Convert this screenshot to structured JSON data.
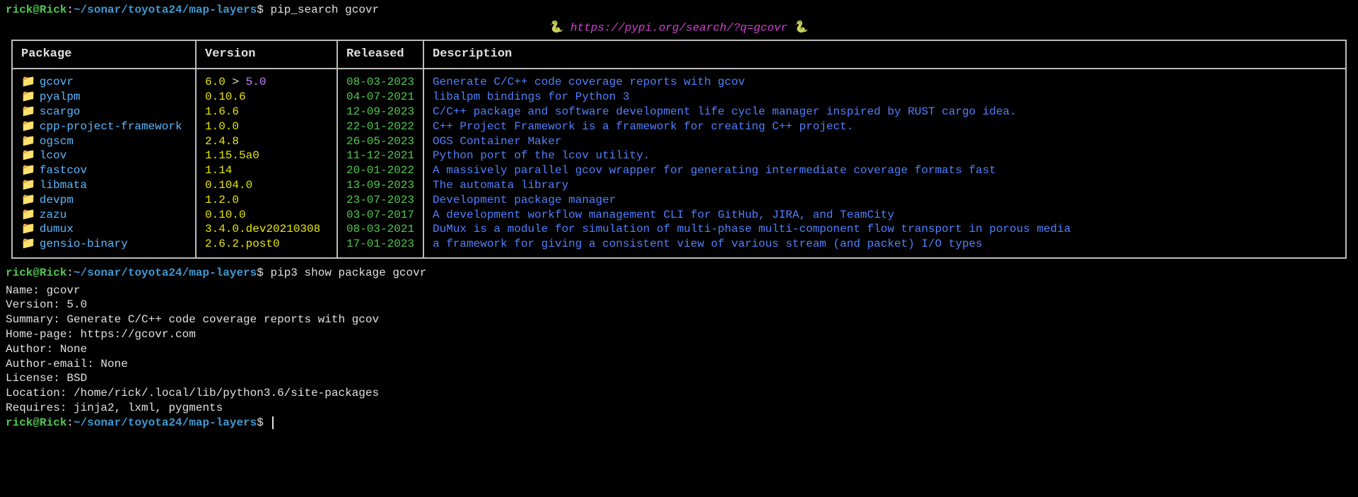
{
  "prompt1": {
    "userhost": "rick@Rick",
    "sep": ":",
    "path": "~/sonar/toyota24/map-layers",
    "dollar": "$",
    "cmd": "pip_search gcovr"
  },
  "search_url": "https://pypi.org/search/?q=gcovr",
  "table": {
    "headers": {
      "pkg": "Package",
      "ver": "Version",
      "rel": "Released",
      "desc": "Description"
    },
    "rows": [
      {
        "name": "gcovr",
        "ver_a": "6.0",
        "ver_op": " > ",
        "ver_b": "5.0",
        "released": "08-03-2023",
        "desc": "Generate C/C++ code coverage reports with gcov"
      },
      {
        "name": "pyalpm",
        "ver_a": "0.10.6",
        "released": "04-07-2021",
        "desc": "libalpm bindings for Python 3"
      },
      {
        "name": "scargo",
        "ver_a": "1.6.6",
        "released": "12-09-2023",
        "desc": "C/C++ package and software development life cycle manager inspired by RUST cargo idea."
      },
      {
        "name": "cpp-project-framework",
        "ver_a": "1.0.0",
        "released": "22-01-2022",
        "desc": "C++ Project Framework is a framework for creating C++ project."
      },
      {
        "name": "ogscm",
        "ver_a": "2.4.8",
        "released": "26-05-2023",
        "desc": "OGS Container Maker"
      },
      {
        "name": "lcov",
        "ver_a": "1.15.5a0",
        "released": "11-12-2021",
        "desc": "Python port of the lcov utility."
      },
      {
        "name": "fastcov",
        "ver_a": "1.14",
        "released": "20-01-2022",
        "desc": "A massively parallel gcov wrapper for generating intermediate coverage formats fast"
      },
      {
        "name": "libmata",
        "ver_a": "0.104.0",
        "released": "13-09-2023",
        "desc": "The automata library"
      },
      {
        "name": "devpm",
        "ver_a": "1.2.0",
        "released": "23-07-2023",
        "desc": "Development package manager"
      },
      {
        "name": "zazu",
        "ver_a": "0.10.0",
        "released": "03-07-2017",
        "desc": "A development workflow management CLI for GitHub, JIRA, and TeamCity"
      },
      {
        "name": "dumux",
        "ver_a": "3.4.0.dev20210308",
        "released": "08-03-2021",
        "desc": "DuMux is a module for simulation of multi-phase multi-component flow transport in porous media"
      },
      {
        "name": "gensio-binary",
        "ver_a": "2.6.2.post0",
        "released": "17-01-2023",
        "desc": "a framework for giving a consistent view of various stream (and packet) I/O types"
      }
    ]
  },
  "prompt2": {
    "userhost": "rick@Rick",
    "sep": ":",
    "path": "~/sonar/toyota24/map-layers",
    "dollar": "$",
    "cmd": "pip3 show package gcovr"
  },
  "info": {
    "name": "Name: gcovr",
    "version": "Version: 5.0",
    "summary": "Summary: Generate C/C++ code coverage reports with gcov",
    "homepage": "Home-page: https://gcovr.com",
    "author": "Author: None",
    "authoremail": "Author-email: None",
    "license": "License: BSD",
    "location": "Location: /home/rick/.local/lib/python3.6/site-packages",
    "requires": "Requires: jinja2, lxml, pygments"
  },
  "prompt3": {
    "userhost": "rick@Rick",
    "sep": ":",
    "path": "~/sonar/toyota24/map-layers",
    "dollar": "$"
  }
}
